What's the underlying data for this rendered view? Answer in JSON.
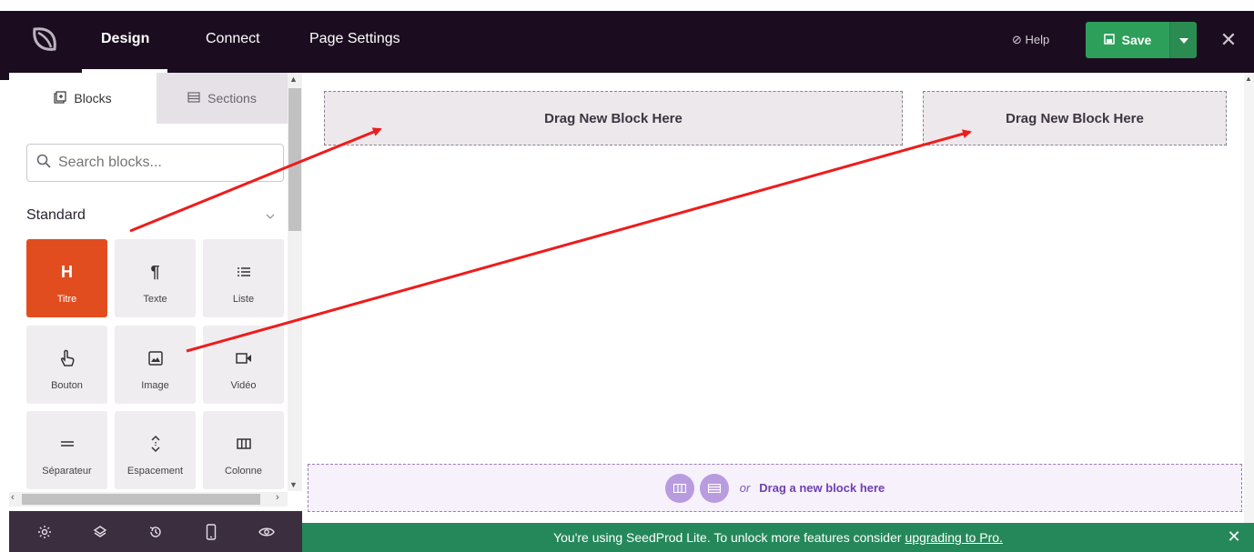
{
  "topbar": {
    "tabs": [
      {
        "label": "Design",
        "active": true
      },
      {
        "label": "Connect",
        "active": false
      },
      {
        "label": "Page Settings",
        "active": false
      }
    ],
    "help_label": "Help",
    "save_label": "Save",
    "icons": {
      "logo": "seedprod-logo-icon",
      "help": "help-circle-icon",
      "save": "save-disk-icon",
      "dropdown": "caret-down-icon",
      "close": "close-icon"
    }
  },
  "sidebar": {
    "tabs": [
      {
        "label": "Blocks",
        "active": true,
        "icon": "blocks-icon"
      },
      {
        "label": "Sections",
        "active": false,
        "icon": "sections-icon"
      }
    ],
    "search": {
      "placeholder": "Search blocks..."
    },
    "category": {
      "title": "Standard",
      "expanded": true
    },
    "blocks": [
      {
        "label": "Titre",
        "icon": "heading-icon",
        "glyph": "H",
        "active": true
      },
      {
        "label": "Texte",
        "icon": "paragraph-icon",
        "glyph": "¶",
        "active": false
      },
      {
        "label": "Liste",
        "icon": "list-icon",
        "glyph": "≡",
        "active": false
      },
      {
        "label": "Bouton",
        "icon": "pointer-icon",
        "active": false
      },
      {
        "label": "Image",
        "icon": "image-icon",
        "active": false
      },
      {
        "label": "Vidéo",
        "icon": "video-icon",
        "active": false
      },
      {
        "label": "Séparateur",
        "icon": "divider-icon",
        "glyph": "═",
        "active": false
      },
      {
        "label": "Espacement",
        "icon": "spacer-icon",
        "active": false
      },
      {
        "label": "Colonne",
        "icon": "columns-icon",
        "active": false
      }
    ],
    "bottom_icons": [
      "settings-icon",
      "layers-icon",
      "history-icon",
      "mobile-icon",
      "preview-eye-icon"
    ]
  },
  "canvas": {
    "drop_zones": [
      "Drag New Block Here",
      "Drag New Block Here"
    ],
    "section_drop": {
      "or_text": "or",
      "link_text": "Drag a new block here"
    }
  },
  "notice": {
    "text": "You're using SeedProd Lite. To unlock more features consider",
    "link": "upgrading to Pro."
  },
  "colors": {
    "topbar_bg": "#1b0d1f",
    "accent_orange": "#e14d1f",
    "save_green": "#2e9e5b",
    "notice_green": "#25885a",
    "purple": "#6f3fb0",
    "arrow_red": "#ee1c1c"
  }
}
